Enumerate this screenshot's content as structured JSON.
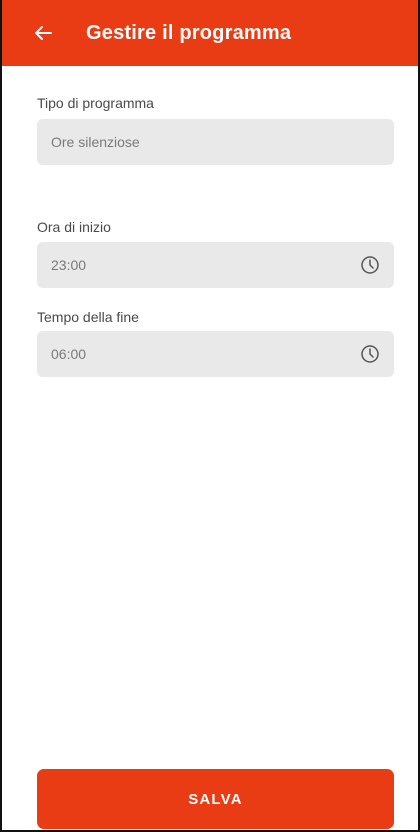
{
  "header": {
    "title": "Gestire il programma",
    "back_icon": "back-arrow-icon"
  },
  "form": {
    "program_type": {
      "label": "Tipo di programma",
      "value": "Ore silenziose"
    },
    "start_time": {
      "label": "Ora di inizio",
      "value": "23:00",
      "icon": "clock-icon"
    },
    "end_time": {
      "label": "Tempo della fine",
      "value": "06:00",
      "icon": "clock-icon"
    }
  },
  "actions": {
    "save_label": "SALVA"
  },
  "colors": {
    "accent": "#EA3C14",
    "field_bg": "#E9E9E9"
  }
}
